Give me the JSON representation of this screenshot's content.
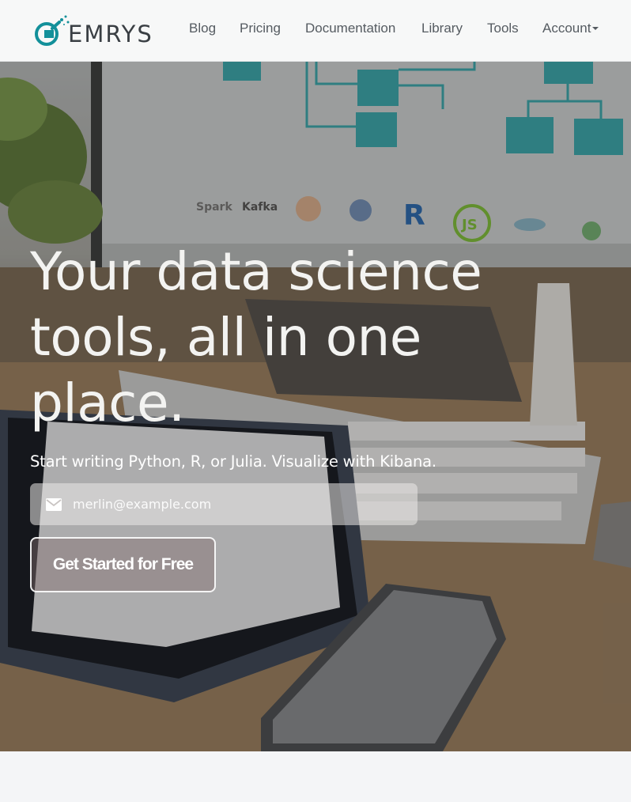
{
  "brand": {
    "name": "EMRYS",
    "logo_icon": "flask-logo-icon",
    "logo_color": "#13909a"
  },
  "nav": {
    "items": [
      {
        "label": "Blog"
      },
      {
        "label": "Pricing"
      },
      {
        "label": "Documentation"
      },
      {
        "label": "Library"
      },
      {
        "label": "Tools"
      },
      {
        "label": "Account",
        "has_dropdown": true
      }
    ]
  },
  "hero": {
    "headline": "Your data science tools, all in one place.",
    "subline": "Start writing Python, R, or Julia. Visualize with Kibana.",
    "email": {
      "icon": "envelope-icon",
      "placeholder": "merlin@example.com",
      "value": ""
    },
    "cta_label": "Get Started for Free",
    "background_image": "desk with monitor, tablet, keyboard and phone",
    "screen_logos": [
      {
        "text": "R",
        "color": "#2a6ab0"
      },
      {
        "text": "JS",
        "color": "#7fbf3a"
      }
    ]
  },
  "colors": {
    "nav_bg": "#f7f8f8",
    "nav_text": "#555b61",
    "accent": "#13909a",
    "page_bg": "#f4f5f7"
  }
}
